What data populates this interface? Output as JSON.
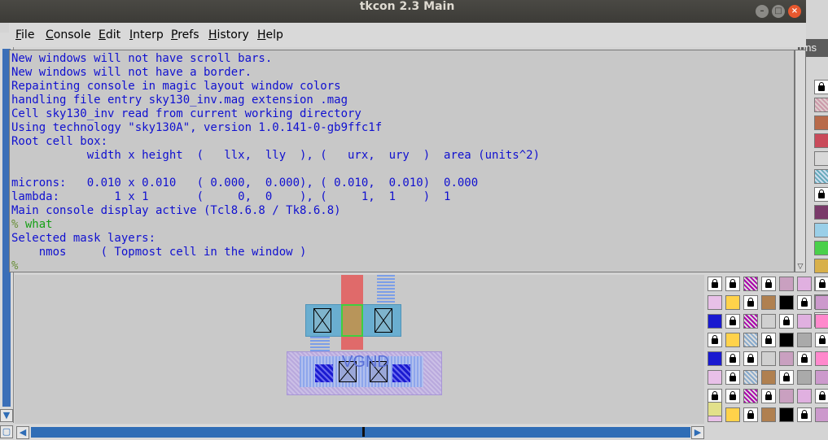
{
  "window": {
    "title": "tkcon 2.3 Main",
    "buttons": [
      "–",
      "□",
      "×"
    ]
  },
  "menu": {
    "items": [
      {
        "label": "File",
        "mnemonic": "F",
        "rest": "ile"
      },
      {
        "label": "Console",
        "mnemonic": "C",
        "rest": "onsole"
      },
      {
        "label": "Edit",
        "mnemonic": "E",
        "rest": "dit"
      },
      {
        "label": "Interp",
        "mnemonic": "I",
        "rest": "nterp"
      },
      {
        "label": "Prefs",
        "mnemonic": "P",
        "rest": "refs"
      },
      {
        "label": "History",
        "mnemonic": "H",
        "rest": "istory"
      },
      {
        "label": "Help",
        "mnemonic": "H",
        "rest": "elp"
      }
    ]
  },
  "console": {
    "lines": [
      "New windows will not have scroll bars.",
      "New windows will not have a border.",
      "Repainting console in magic layout window colors",
      "handling file entry sky130_inv.mag extension .mag",
      "Cell sky130_inv read from current working directory",
      "Using technology \"sky130A\", version 1.0.141-0-gb9ffc1f",
      "Root cell box:",
      "           width x height  (   llx,  lly  ), (   urx,  ury  )  area (units^2)",
      "",
      "microns:   0.010 x 0.010   ( 0.000,  0.000), ( 0.010,  0.010)  0.000",
      "lambda:        1 x 1       (     0,  0    ), (     1,  1    )  1",
      "Main console display active (Tcl8.6.8 / Tk8.6.8)"
    ],
    "prompt_symbol": "%",
    "command": " what",
    "output_lines": [
      "Selected mask layers:",
      "    nmos     ( Topmost cell in the window )"
    ],
    "current_prompt": "%"
  },
  "background_window": {
    "palette_label": "ons",
    "layout_label": "VGND"
  },
  "colors": {
    "console_text": "#1010d0",
    "command_text": "#16a016",
    "console_bg": "#c8c8c8",
    "scroll_blue": "#2f6db6"
  }
}
